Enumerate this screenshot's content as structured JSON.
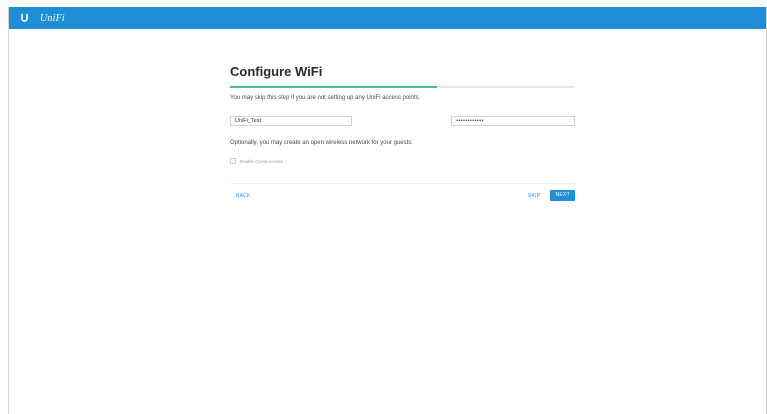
{
  "app": {
    "brand": "UniFi",
    "accent_color": "#1e8fd6",
    "logo_icon": "ubiquiti-u-icon"
  },
  "wizard": {
    "title": "Configure WiFi",
    "progress_fraction": 0.6,
    "progress_color": "#4bbf8c",
    "hint": "You may skip this step if you are not setting up any UniFi access points.",
    "ssid_value": "UniFi_Test",
    "password_value": "••••••••••••",
    "optional_text": "Optionally, you may create an open wireless network for your guests:",
    "guest_checkbox_label": "Enable Guest Access",
    "guest_checked": false,
    "back_label": "BACK",
    "skip_label": "SKIP",
    "next_label": "NEXT"
  }
}
